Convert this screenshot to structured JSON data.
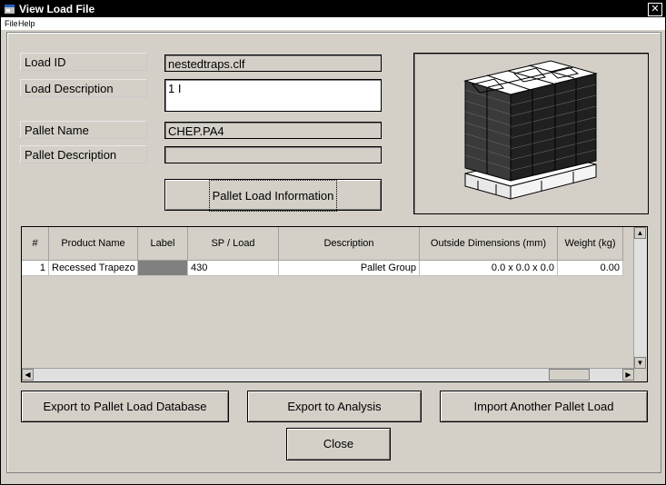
{
  "window": {
    "title": "View Load File",
    "close_glyph": "✕"
  },
  "menu": {
    "file": "File",
    "help": "Help"
  },
  "form": {
    "load_id_label": "Load ID",
    "load_id_value": "nestedtraps.clf",
    "load_desc_label": "Load Description",
    "load_desc_value": "1 I",
    "pallet_name_label": "Pallet Name",
    "pallet_name_value": "CHEP.PA4",
    "pallet_desc_label": "Pallet Description",
    "pallet_desc_value": ""
  },
  "buttons": {
    "pallet_info": "Pallet Load Information",
    "export_db": "Export to Pallet Load Database",
    "export_analysis": "Export to Analysis",
    "import_another": "Import Another Pallet Load",
    "close": "Close"
  },
  "table": {
    "headers": [
      "#",
      "Product Name",
      "Label",
      "SP / Load",
      "Description",
      "Outside Dimensions (mm)",
      "Weight (kg)"
    ],
    "rows": [
      [
        "1",
        "Recessed Trapezo",
        "",
        "430",
        "Pallet Group",
        "0.0 x 0.0 x 0.0",
        "0.00"
      ]
    ]
  },
  "icons": {
    "app": "app-window-icon",
    "close": "close-icon",
    "image": "pallet-load-icon"
  }
}
